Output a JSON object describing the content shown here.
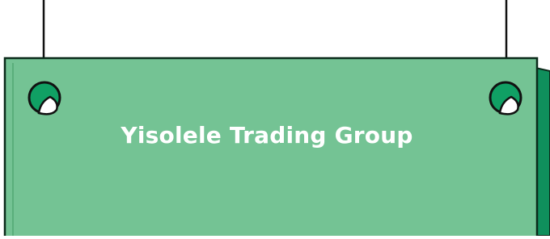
{
  "sign": {
    "title": "Yisolele Trading Group"
  },
  "colors": {
    "board_fill": "#74c394",
    "board_shade": "#0f8f5c",
    "board_outline": "#0b2a1a",
    "hole_green": "#10a064",
    "hole_white": "#ffffff",
    "string": "#111111",
    "text": "#ffffff"
  },
  "icons": {
    "left_hole": "grommet-hole-icon",
    "right_hole": "grommet-hole-icon"
  }
}
